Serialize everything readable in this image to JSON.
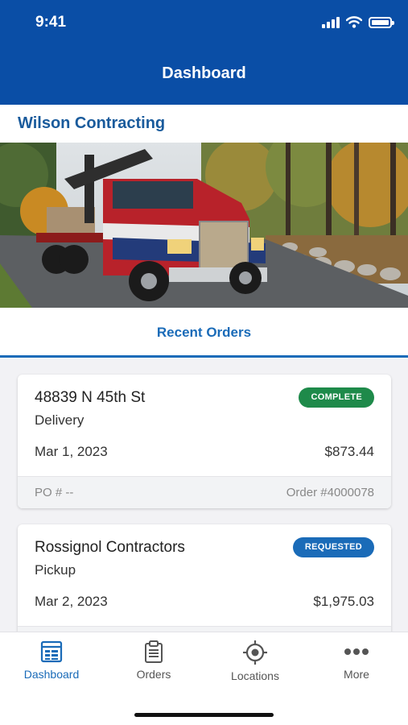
{
  "status_bar": {
    "time": "9:41"
  },
  "header": {
    "title": "Dashboard"
  },
  "company": {
    "name": "Wilson Contracting"
  },
  "section": {
    "title": "Recent Orders"
  },
  "orders": [
    {
      "address": "48839 N 45th St",
      "type": "Delivery",
      "date": "Mar 1, 2023",
      "total": "$873.44",
      "status": "COMPLETE",
      "po": "PO # --",
      "order_number": "Order #4000078"
    },
    {
      "address": "Rossignol Contractors",
      "type": "Pickup",
      "date": "Mar 2, 2023",
      "total": "$1,975.03",
      "status": "REQUESTED",
      "po": "",
      "order_number": ""
    }
  ],
  "tabs": [
    {
      "label": "Dashboard",
      "icon": "dashboard-icon",
      "active": true
    },
    {
      "label": "Orders",
      "icon": "clipboard-icon",
      "active": false
    },
    {
      "label": "Locations",
      "icon": "location-crosshair-icon",
      "active": false
    },
    {
      "label": "More",
      "icon": "more-dots-icon",
      "active": false
    }
  ],
  "colors": {
    "header": "#0a4ea6",
    "accent": "#1a6bb8",
    "complete": "#1e8a4a",
    "requested": "#1a6bb8"
  }
}
